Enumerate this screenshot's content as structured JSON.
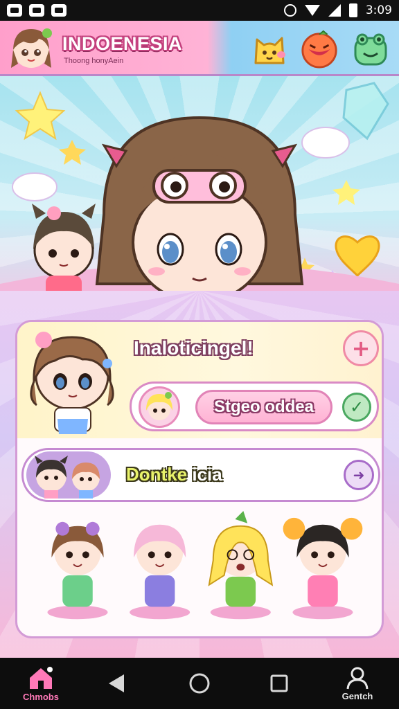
{
  "status_bar": {
    "time": "3:09"
  },
  "header": {
    "title": "INDOENESIA",
    "subtitle": "Thoong honyAein",
    "buttons": [
      {
        "name": "cat-face-icon",
        "color": "#ffd54a"
      },
      {
        "name": "tomato-face-icon",
        "color": "#ff7a45"
      },
      {
        "name": "frog-face-icon",
        "color": "#7fdc9a"
      }
    ]
  },
  "card": {
    "row1_title": "Inaloticingel!",
    "row1_action": "+",
    "status_label": "Stgeo oddea",
    "status_check": "✓",
    "row2_label_a": "Dontke",
    "row2_label_b": " icia",
    "row2_action": "➜"
  },
  "nav": {
    "home_label": "Chmobs",
    "profile_label": "Gentch"
  },
  "colors": {
    "accent_pink": "#ff9fcb",
    "accent_blue": "#8fd0f3",
    "card_border": "#d39bd6",
    "home_label": "#ff79b8"
  }
}
